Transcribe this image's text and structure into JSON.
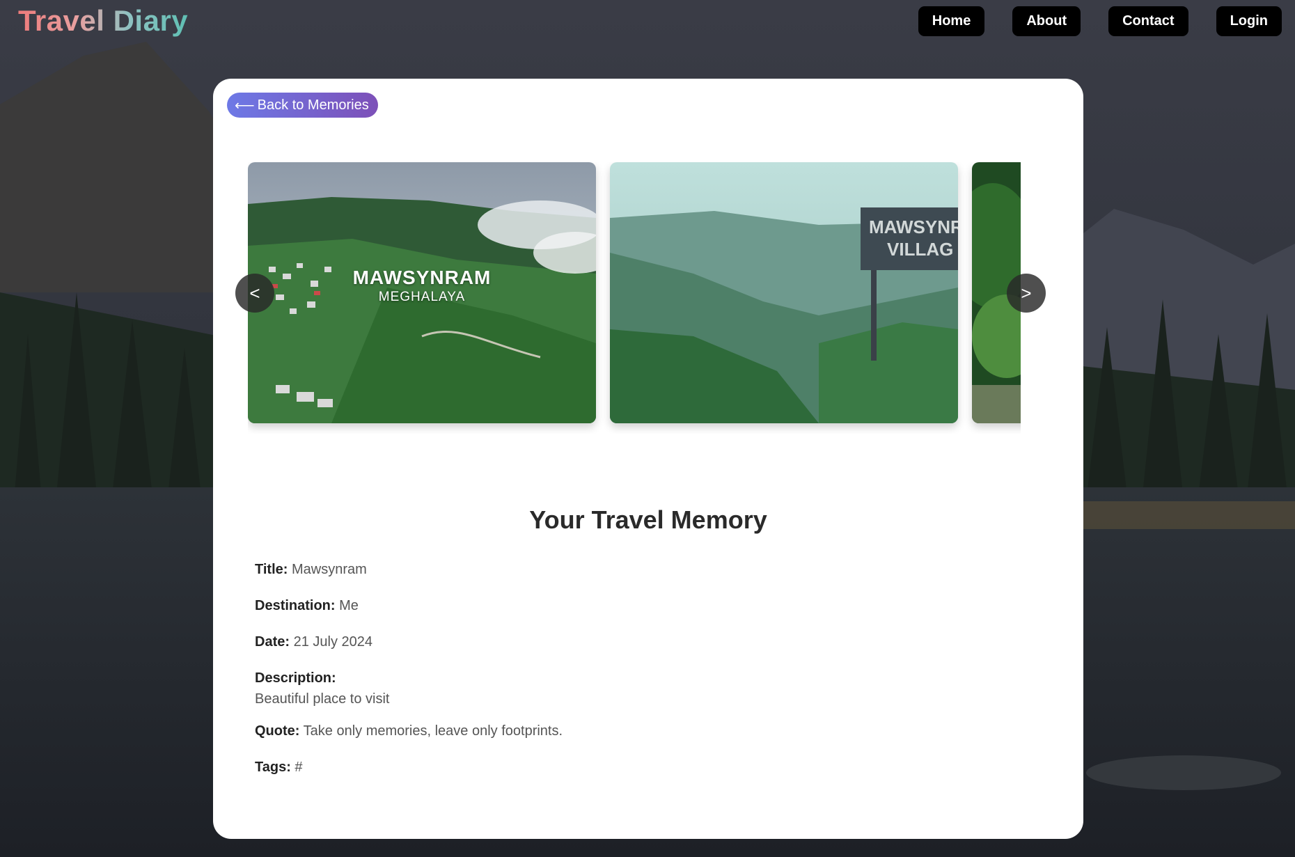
{
  "header": {
    "logo": "Travel Diary",
    "nav": [
      {
        "label": "Home"
      },
      {
        "label": "About"
      },
      {
        "label": "Contact"
      },
      {
        "label": "Login"
      }
    ]
  },
  "card": {
    "back_label": "Back to Memories",
    "back_icon": "arrow-left-icon",
    "carousel": {
      "prev_label": "<",
      "next_label": ">",
      "slides": [
        {
          "caption_main": "MAWSYNRAM",
          "caption_sub": "MEGHALAYA"
        },
        {
          "sign_text_1": "MAWSYNRA",
          "sign_text_2": "VILLAG"
        },
        {}
      ]
    },
    "heading": "Your Travel Memory",
    "details": {
      "title_label": "Title:",
      "title_value": "Mawsynram",
      "destination_label": "Destination:",
      "destination_value": "Me",
      "date_label": "Date:",
      "date_value": "21 July 2024",
      "description_label": "Description:",
      "description_value": "Beautiful place to visit",
      "quote_label": "Quote:",
      "quote_value": "Take only memories, leave only footprints.",
      "tags_label": "Tags:",
      "tags_value": "#"
    }
  },
  "colors": {
    "button_bg": "#000000",
    "back_gradient_start": "#6d79e6",
    "back_gradient_end": "#7d50b8",
    "card_bg": "#ffffff"
  }
}
